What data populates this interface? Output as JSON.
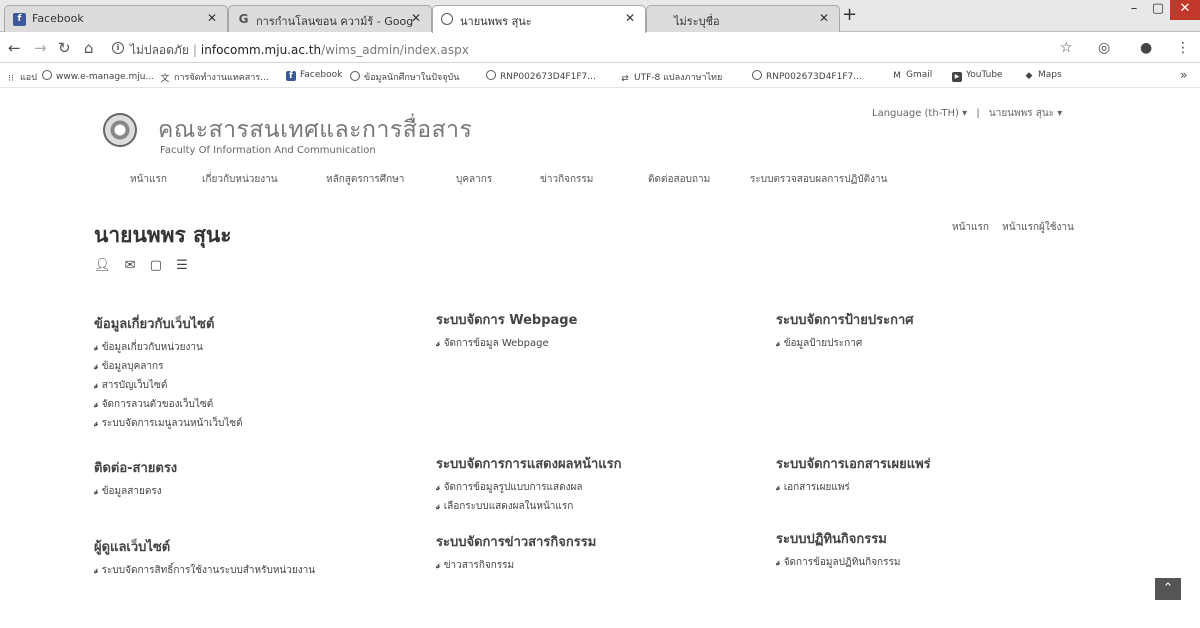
{
  "browser": {
    "tabs": [
      {
        "title": "Facebook",
        "favicon": "facebook-icon",
        "active": false
      },
      {
        "title": "การกำนโลนขอน ความ์ร้ - Goog",
        "favicon": "google-icon",
        "active": false
      },
      {
        "title": "นายนพพร สุนะ",
        "favicon": "globe-icon",
        "active": true
      },
      {
        "title": "ไม่ระบุชื่อ",
        "favicon": "",
        "active": false
      }
    ],
    "new_tab": "+",
    "address": {
      "secure_label": "ไม่ปลอดภัย",
      "host": "infocomm.mju.ac.th",
      "path": "/wims_admin/index.aspx"
    },
    "bookmarks": [
      {
        "label": "แอป",
        "icon": "apps-grid-icon"
      },
      {
        "label": "www.e-manage.mju...",
        "icon": "globe-icon"
      },
      {
        "label": "การจัดทำงานแทคสาร...",
        "icon": "translate-icon"
      },
      {
        "label": "Facebook",
        "icon": "facebook-icon"
      },
      {
        "label": "ข้อมูลนักศึกษาในปัจจุบัน",
        "icon": "globe-icon"
      },
      {
        "label": "RNP002673D4F1F7...",
        "icon": "globe-icon"
      },
      {
        "label": "UTF-8 แปลงภาษาไทย",
        "icon": "convert-icon"
      },
      {
        "label": "RNP002673D4F1F7...",
        "icon": "globe-icon"
      },
      {
        "label": "Gmail",
        "icon": "gmail-icon"
      },
      {
        "label": "YouTube",
        "icon": "youtube-icon"
      },
      {
        "label": "Maps",
        "icon": "maps-icon"
      }
    ]
  },
  "header": {
    "title_th": "คณะสารสนเทศและการสื่อสาร",
    "title_en": "Faculty Of Information And Communication",
    "language": "Language (th-TH)",
    "user_menu": "นายนพพร สุนะ"
  },
  "nav": [
    "หน้าแรก",
    "เกี่ยวกับหน่วยงาน",
    "หลักสูตรการศึกษา",
    "บุคลากร",
    "ข่าวกิจกรรม",
    "ติดต่อสอบถาม",
    "ระบบตรวจสอบผลการปฏิบัติงาน"
  ],
  "content": {
    "user_name": "นายนพพร สุนะ",
    "page_links": [
      "หน้าแรก",
      "หน้าแรกผู้ใช้งาน"
    ],
    "user_icons": [
      "user-icon",
      "mail-icon",
      "chat-icon",
      "list-icon"
    ],
    "sections": [
      {
        "title": "ข้อมูลเกี่ยวกับเว็บไซต์",
        "links": [
          "ข้อมูลเกี่ยวกับหน่วยงาน",
          "ข้อมูลบุคลากร",
          "สารบัญเว็บไซต์",
          "จัดการลวนตัวของเว็บไซต์",
          "ระบบจัดการเมนูลวนหน้าเว็บไซต์"
        ]
      },
      {
        "title": "ระบบจัดการ Webpage",
        "links": [
          "จัดการข้อมูล Webpage"
        ]
      },
      {
        "title": "ระบบจัดการป้ายประกาศ",
        "links": [
          "ข้อมูลป้ายประกาศ"
        ]
      },
      {
        "title": "ติดต่อ-สายตรง",
        "links": [
          "ข้อมูลสายตรง"
        ]
      },
      {
        "title": "ระบบจัดการการแสดงผลหน้าแรก",
        "links": [
          "จัดการข้อมูลรูปแบบการแสดงผล",
          "เลือกระบบแสดงผลในหน้าแรก"
        ]
      },
      {
        "title": "ระบบจัดการเอกสารเผยแพร่",
        "links": [
          "เอกสารเผยแพร่"
        ]
      },
      {
        "title": "ผู้ดูแลเว็บไซต์",
        "links": [
          "ระบบจัดการสิทธิ์การใช้งานระบบสำหรับหน่วยงาน"
        ]
      },
      {
        "title": "ระบบจัดการข่าวสารกิจกรรม",
        "links": [
          "ข่าวสารกิจกรรม"
        ]
      },
      {
        "title": "ระบบปฏิทินกิจกรรม",
        "links": [
          "จัดการข้อมูลปฏิทินกิจกรรม"
        ]
      }
    ]
  }
}
